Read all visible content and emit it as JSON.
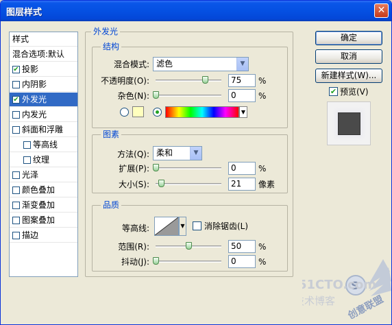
{
  "window": {
    "title": "图层样式",
    "close_glyph": "✕"
  },
  "style_list": {
    "items": [
      {
        "label": "样式",
        "checkbox": false,
        "checked": false,
        "indent": 0,
        "selected": false
      },
      {
        "label": "混合选项:默认",
        "checkbox": false,
        "checked": false,
        "indent": 0,
        "selected": false
      },
      {
        "label": "投影",
        "checkbox": true,
        "checked": true,
        "indent": 0,
        "selected": false
      },
      {
        "label": "内阴影",
        "checkbox": true,
        "checked": false,
        "indent": 0,
        "selected": false
      },
      {
        "label": "外发光",
        "checkbox": true,
        "checked": true,
        "indent": 0,
        "selected": true
      },
      {
        "label": "内发光",
        "checkbox": true,
        "checked": false,
        "indent": 0,
        "selected": false
      },
      {
        "label": "斜面和浮雕",
        "checkbox": true,
        "checked": false,
        "indent": 0,
        "selected": false
      },
      {
        "label": "等高线",
        "checkbox": true,
        "checked": false,
        "indent": 1,
        "selected": false
      },
      {
        "label": "纹理",
        "checkbox": true,
        "checked": false,
        "indent": 1,
        "selected": false
      },
      {
        "label": "光泽",
        "checkbox": true,
        "checked": false,
        "indent": 0,
        "selected": false
      },
      {
        "label": "颜色叠加",
        "checkbox": true,
        "checked": false,
        "indent": 0,
        "selected": false
      },
      {
        "label": "渐变叠加",
        "checkbox": true,
        "checked": false,
        "indent": 0,
        "selected": false
      },
      {
        "label": "图案叠加",
        "checkbox": true,
        "checked": false,
        "indent": 0,
        "selected": false
      },
      {
        "label": "描边",
        "checkbox": true,
        "checked": false,
        "indent": 0,
        "selected": false
      }
    ],
    "check_glyph": "✔"
  },
  "outer_glow": {
    "title": "外发光",
    "structure": {
      "title": "结构",
      "blend_mode": {
        "label": "混合模式:",
        "value": "滤色"
      },
      "opacity": {
        "label": "不透明度(O):",
        "value": "75",
        "unit": "%",
        "level": 0.75
      },
      "noise": {
        "label": "杂色(N):",
        "value": "0",
        "unit": "%",
        "level": 0
      },
      "solid_color": "#ffffbe"
    },
    "elements": {
      "title": "图素",
      "technique": {
        "label": "方法(Q):",
        "value": "柔和"
      },
      "spread": {
        "label": "扩展(P):",
        "value": "0",
        "unit": "%",
        "level": 0
      },
      "size": {
        "label": "大小(S):",
        "value": "21",
        "unit": "像素",
        "level": 0.084
      }
    },
    "quality": {
      "title": "品质",
      "contour": {
        "label": "等高线:"
      },
      "anti_alias": {
        "label": "消除锯齿(L)",
        "checked": false
      },
      "range": {
        "label": "范围(R):",
        "value": "50",
        "unit": "%",
        "level": 0.5
      },
      "jitter": {
        "label": "抖动(J):",
        "value": "0",
        "unit": "%",
        "level": 0
      }
    }
  },
  "buttons": {
    "ok": "确定",
    "cancel": "取消",
    "new_style": "新建样式(W)...",
    "preview_label": "预览(V)",
    "preview_checked": true
  },
  "watermark": {
    "brand": "51CTO.com",
    "sub": "技术博客",
    "logo": "创意联盟"
  },
  "icons": {
    "dropdown": "▼",
    "close": "close-icon"
  }
}
